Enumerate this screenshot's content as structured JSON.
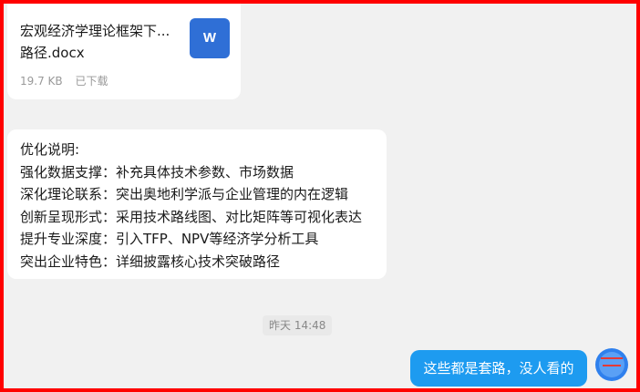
{
  "file_message": {
    "name_line1": "宏观经济学理论框架下...",
    "name_line2": "路径.docx",
    "size": "19.7 KB",
    "status": "已下载",
    "icon": "word-document-icon",
    "icon_letter": "W"
  },
  "text_message": {
    "lines": [
      "优化说明:",
      "强化数据支撑：补充具体技术参数、市场数据",
      "深化理论联系：突出奥地利学派与企业管理的内在逻辑",
      "创新呈现形式：采用技术路线图、对比矩阵等可视化表达",
      "提升专业深度：引入TFP、NPV等经济学分析工具",
      "突出企业特色：详细披露核心技术突破路径"
    ]
  },
  "timestamp": "昨天 14:48",
  "outgoing_message": {
    "text": "这些都是套路，没人看的"
  },
  "colors": {
    "frame_border": "#ff0000",
    "chat_background": "#f1f1f1",
    "incoming_bubble": "#ffffff",
    "outgoing_bubble": "#1d9bf0",
    "word_icon": "#2f6fd6"
  }
}
